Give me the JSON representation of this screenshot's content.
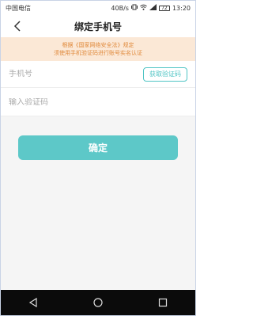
{
  "status_bar": {
    "carrier": "中国电信",
    "speed": "40B/s",
    "battery": "72",
    "time": "13:20"
  },
  "header": {
    "title": "绑定手机号",
    "back_icon": "chevron-left-icon"
  },
  "notice": {
    "line1": "根据《国家网络安全法》规定",
    "line2": "须使用手机验证码进行账号实名认证",
    "color": "#e08a3c",
    "background": "#fbe8d6"
  },
  "form": {
    "phone_placeholder": "手机号",
    "code_placeholder": "输入验证码",
    "get_code_label": "获取验证码",
    "confirm_label": "确定",
    "accent_color": "#5dc8c8"
  },
  "nav_bar": {
    "back_icon": "triangle-back-icon",
    "home_icon": "circle-home-icon",
    "recents_icon": "square-recents-icon"
  }
}
